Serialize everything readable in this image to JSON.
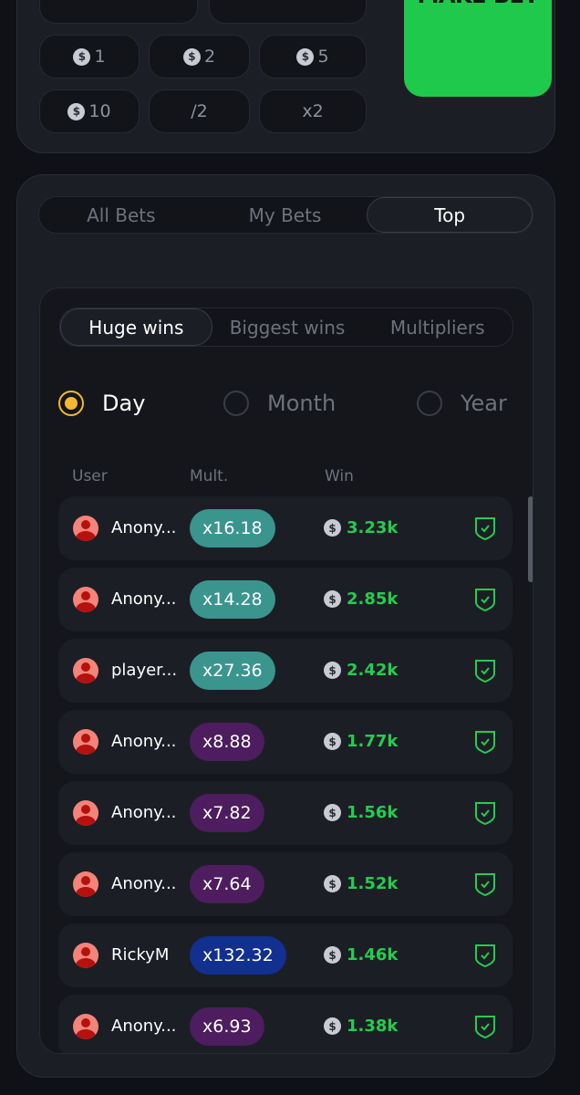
{
  "bet_panel": {
    "chips": [
      {
        "label": "1",
        "coin": true
      },
      {
        "label": "2",
        "coin": true
      },
      {
        "label": "5",
        "coin": true
      },
      {
        "label": "10",
        "coin": true
      },
      {
        "label": "/2",
        "coin": false
      },
      {
        "label": "x2",
        "coin": false
      }
    ],
    "make_bet": "MAKE BET"
  },
  "bets_tabs": [
    {
      "label": "All Bets",
      "active": false
    },
    {
      "label": "My Bets",
      "active": false
    },
    {
      "label": "Top",
      "active": true
    }
  ],
  "top_tabs": [
    {
      "label": "Huge wins",
      "active": true
    },
    {
      "label": "Biggest wins",
      "active": false
    },
    {
      "label": "Multipliers",
      "active": false
    }
  ],
  "periods": [
    {
      "label": "Day",
      "selected": true
    },
    {
      "label": "Month",
      "selected": false
    },
    {
      "label": "Year",
      "selected": false
    }
  ],
  "columns": {
    "user": "User",
    "mult": "Mult.",
    "win": "Win"
  },
  "rows": [
    {
      "user": "Anony...",
      "mult": "x16.18",
      "win": "3.23k",
      "color": "#3a958f"
    },
    {
      "user": "Anony...",
      "mult": "x14.28",
      "win": "2.85k",
      "color": "#3a958f"
    },
    {
      "user": "player...",
      "mult": "x27.36",
      "win": "2.42k",
      "color": "#3a958f"
    },
    {
      "user": "Anony...",
      "mult": "x8.88",
      "win": "1.77k",
      "color": "#4d1d5f"
    },
    {
      "user": "Anony...",
      "mult": "x7.82",
      "win": "1.56k",
      "color": "#4d1d5f"
    },
    {
      "user": "Anony...",
      "mult": "x7.64",
      "win": "1.52k",
      "color": "#4d1d5f"
    },
    {
      "user": "RickyM",
      "mult": "x132.32",
      "win": "1.46k",
      "color": "#12308f"
    },
    {
      "user": "Anony...",
      "mult": "x6.93",
      "win": "1.38k",
      "color": "#4d1d5f"
    }
  ],
  "colors": {
    "accent": "#1ec94c",
    "win": "#25cc4f",
    "radio": "#f5b82e"
  }
}
